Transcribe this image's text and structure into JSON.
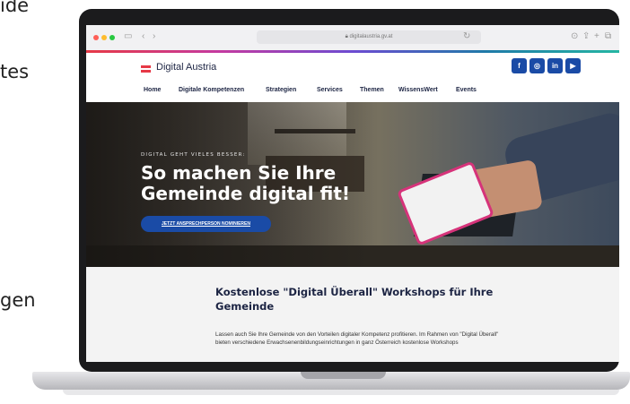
{
  "side_text": [
    "ide",
    "tes",
    "gen"
  ],
  "browser": {
    "url": "digitalaustria.gv.at"
  },
  "site": {
    "logo_text": "Digital Austria",
    "flag_colors": [
      "#e63946",
      "#ffffff",
      "#e63946"
    ],
    "social": [
      {
        "icon": "facebook-icon",
        "glyph": "f"
      },
      {
        "icon": "instagram-icon",
        "glyph": "◎"
      },
      {
        "icon": "linkedin-icon",
        "glyph": "in"
      },
      {
        "icon": "youtube-icon",
        "glyph": "▶"
      }
    ],
    "nav": [
      "Home",
      "Digitale Kompetenzen",
      "Strategien",
      "Services",
      "Themen",
      "WissensWert",
      "Events"
    ]
  },
  "hero": {
    "eyebrow": "DIGITAL GEHT VIELES BESSER:",
    "title": "So machen Sie Ihre Gemeinde digital fit!",
    "cta": "JETZT ANSPRECHPERSON NOMINIEREN"
  },
  "content": {
    "title": "Kostenlose \"Digital Überall\" Workshops für Ihre Gemeinde",
    "body": "Lassen auch Sie Ihre Gemeinde von den Vorteilen digitaler Kompetenz profitieren. Im Rahmen von \"Digital Überall\" bieten verschiedene Erwachsenenbildungseinrichtungen in ganz Österreich kostenlose Workshops"
  },
  "colors": {
    "brand_blue": "#1a4ba6",
    "navy": "#1c2443"
  }
}
